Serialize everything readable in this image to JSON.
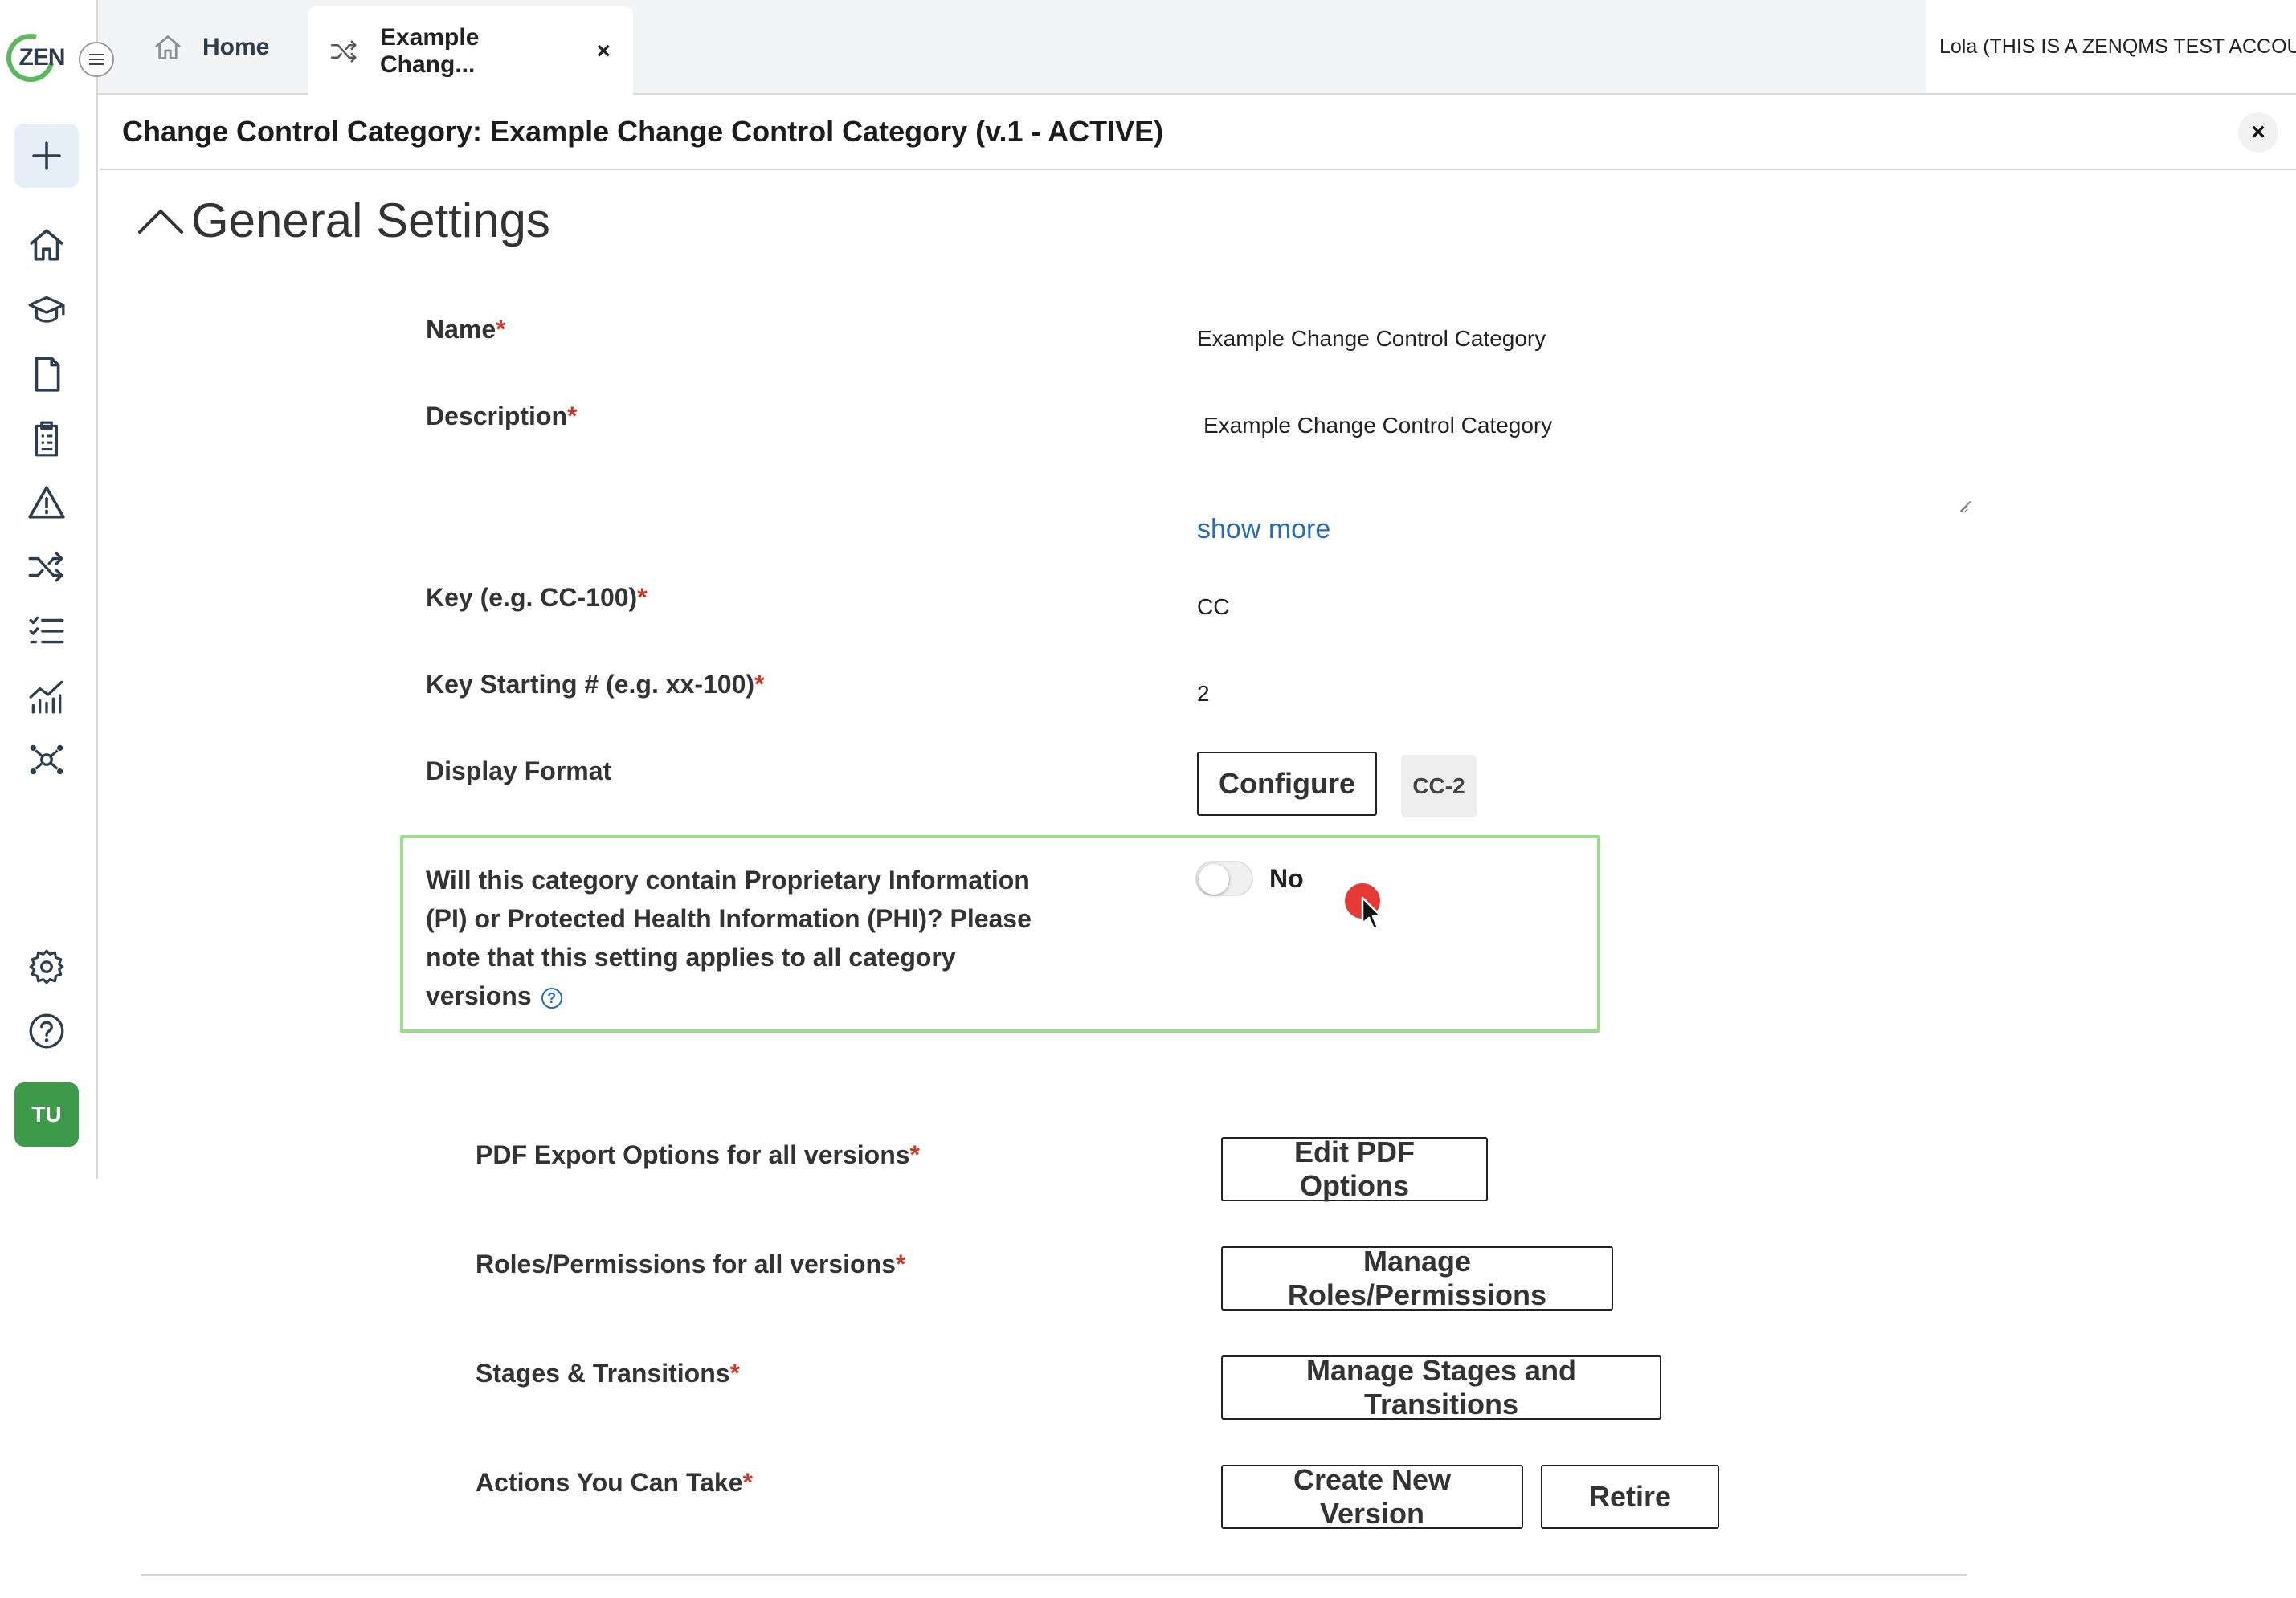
{
  "logo": {
    "text": "ZEN"
  },
  "tabs": [
    {
      "label": "Home",
      "icon": "home-icon",
      "active": false
    },
    {
      "label": "Example Chang...",
      "icon": "shuffle-icon",
      "active": true,
      "close": "×"
    }
  ],
  "user": {
    "name": "Lola (THIS IS A ZENQMS TEST ACCOUNT)"
  },
  "avatar": {
    "initials": "TU"
  },
  "page": {
    "title": "Change Control Category: Example Change Control Category (v.1 - ACTIVE)",
    "close": "×"
  },
  "section": {
    "title": "General Settings"
  },
  "fields": {
    "name": {
      "label": "Name",
      "required": "*",
      "value": "Example Change Control Category"
    },
    "description": {
      "label": "Description",
      "required": "*",
      "value": "Example Change Control Category",
      "show_more": "show more"
    },
    "key": {
      "label": "Key (e.g. CC-100)",
      "required": "*",
      "value": "CC"
    },
    "key_start": {
      "label": "Key Starting # (e.g. xx-100)",
      "required": "*",
      "value": "2"
    },
    "display_format": {
      "label": "Display Format",
      "button": "Configure",
      "preview": "CC-2"
    },
    "pi_phi": {
      "question": "Will this category contain Proprietary Information (PI) or Protected Health Information (PHI)? Please note that this setting applies to all category versions",
      "help": "?",
      "toggle_value": "No",
      "enabled": false
    },
    "pdf_export": {
      "label": "PDF Export Options for all versions",
      "required": "*",
      "button": "Edit PDF Options"
    },
    "roles": {
      "label": "Roles/Permissions for all versions",
      "required": "*",
      "button": "Manage Roles/Permissions"
    },
    "stages": {
      "label": "Stages & Transitions",
      "required": "*",
      "button": "Manage Stages and Transitions"
    },
    "actions": {
      "label": "Actions You Can Take",
      "required": "*",
      "buttons": [
        "Create New Version",
        "Retire"
      ]
    }
  },
  "colors": {
    "accent_link": "#2a6db3",
    "required": "#c0392b",
    "highlight_border": "#9ddc8f",
    "avatar_bg": "#3d9a48",
    "cursor": "#e53935"
  }
}
